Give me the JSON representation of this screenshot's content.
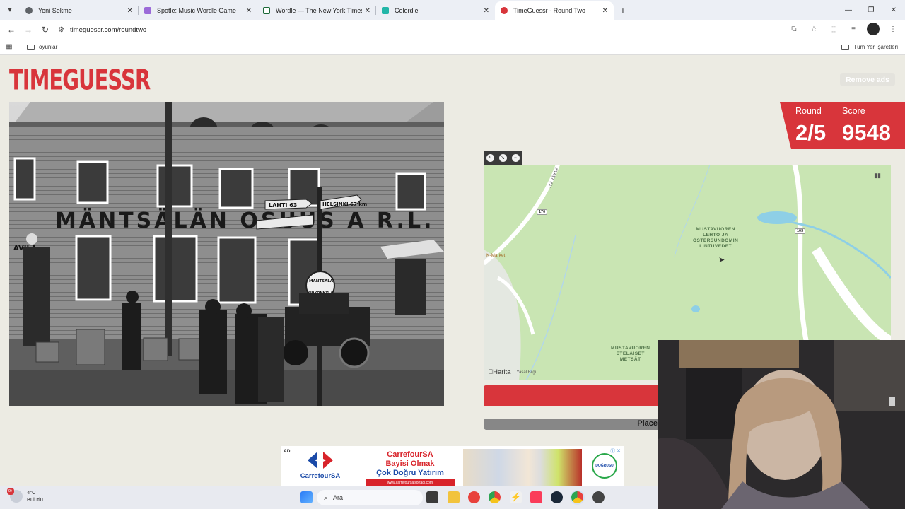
{
  "browser": {
    "tabs": [
      {
        "title": "Yeni Sekme",
        "color": "#5f6368"
      },
      {
        "title": "Spotle: Music Wordle Game",
        "color": "#9b6ad8"
      },
      {
        "title": "Wordle — The New York Times",
        "color": "#1e6b3a"
      },
      {
        "title": "Colordle",
        "color": "#23b6a8"
      },
      {
        "title": "TimeGuessr - Round Two",
        "color": "#d8353b"
      }
    ],
    "url": "timeguessr.com/roundtwo",
    "bookmark": "oyunlar",
    "all_bookmarks": "Tüm Yer İşaretleri"
  },
  "page": {
    "logo": "TIMEGUESSR",
    "remove_ads": "Remove ads",
    "round_label": "Round",
    "round_value": "2/5",
    "score_label": "Score",
    "score_value": "9548",
    "place_label": "Place"
  },
  "photo": {
    "sign_text": "MÄNTSÄLÄN OSUUS  A R.L.",
    "left_sign": "AVILA",
    "arrow_1": "LAHTI 63",
    "arrow_2": "HELSINKI 67 km",
    "round_sign_top": "MÄNTSÄLÄ",
    "round_sign_bottom": "KIRKONKYLÄ"
  },
  "map": {
    "label_top_line1": "MUSTAVUOREN",
    "label_top_line2": "LEHTO JA",
    "label_top_line3": "ÖSTERSUNDOMIN",
    "label_top_line4": "LINTUVEDET",
    "label_bottom_line1": "MUSTAVUOREN",
    "label_bottom_line2": "ETELÄISET",
    "label_bottom_line3": "METSÄT",
    "road_itavayla": "ITÄVÄYLÄ",
    "shield_170": "170",
    "shield_103": "103",
    "kmarket": "K-Market",
    "attribution": "Harita",
    "legal": "Yasal Bilgi"
  },
  "ad": {
    "tag": "AD",
    "brand": "CarrefourSA",
    "line1": "CarrefourSA",
    "line2": "Bayisi Olmak",
    "line3": "Çok Doğru Yatırım",
    "url": "www.carrefoursaisortagi.com",
    "badge": "DOĞRUSU"
  },
  "taskbar": {
    "temp": "4°C",
    "weather": "Bulutlu",
    "badge": "9+",
    "search": "Ara"
  }
}
